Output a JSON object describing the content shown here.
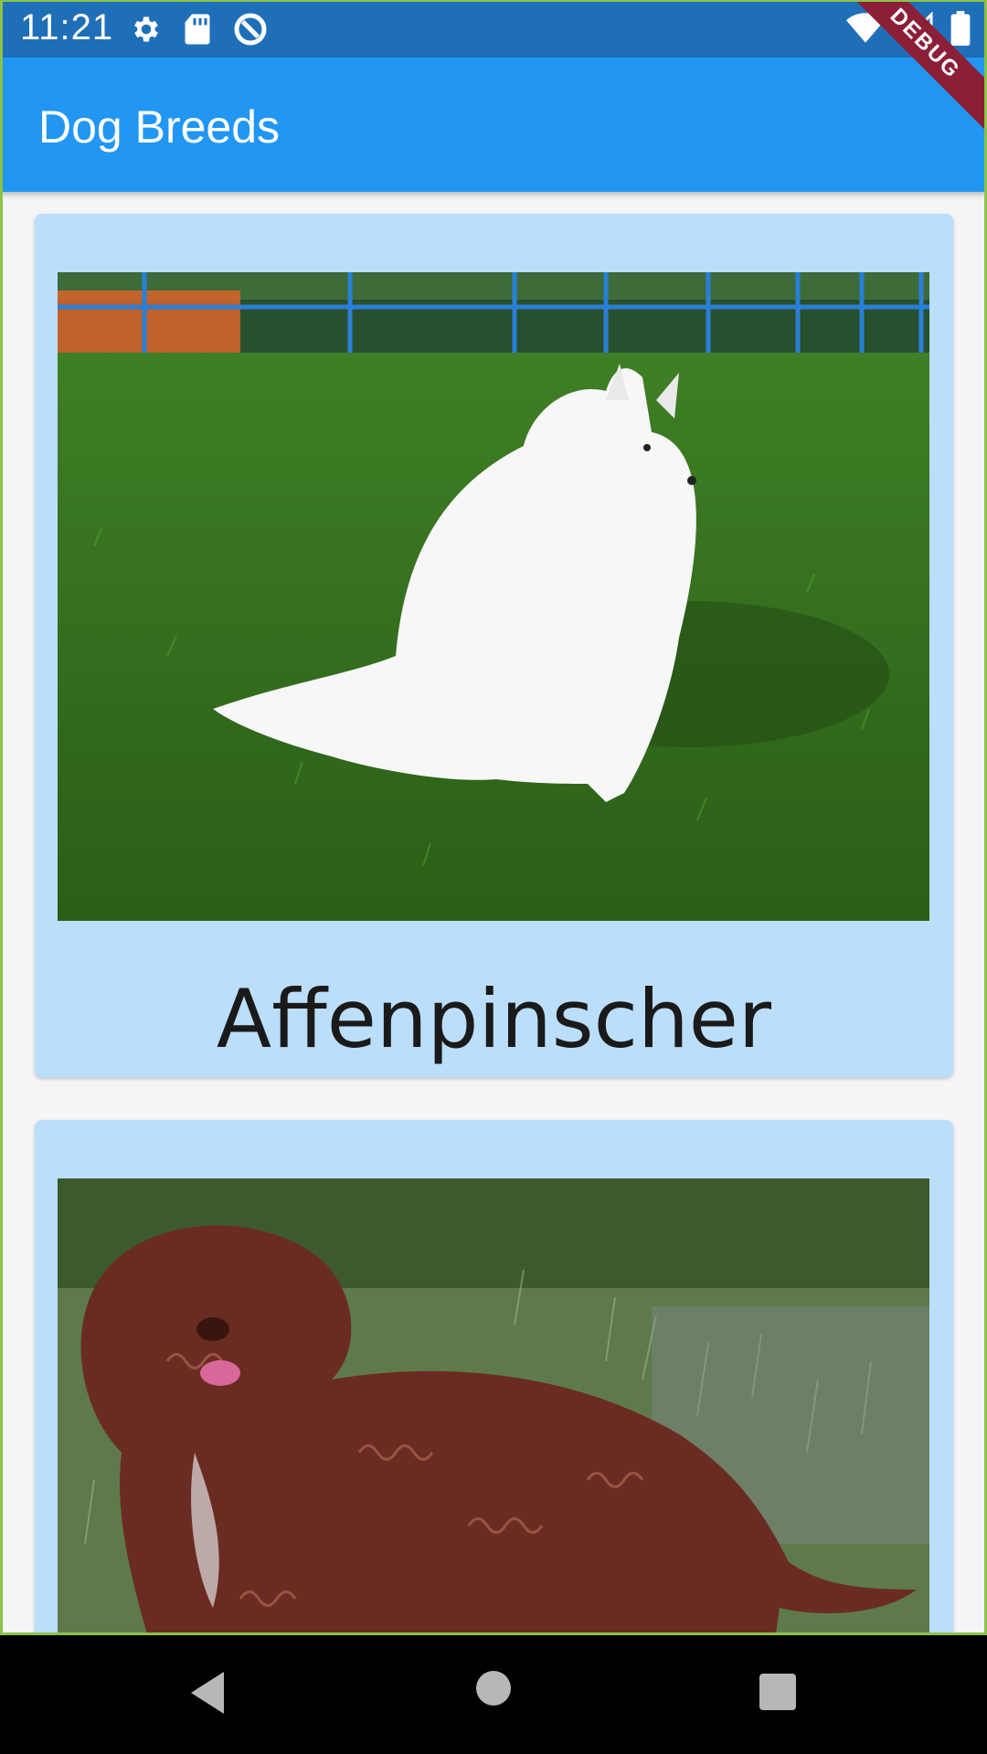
{
  "status_bar": {
    "time": "11:21",
    "icons_left": [
      "gear-icon",
      "sd-card-icon",
      "data-saver-icon"
    ],
    "icons_right": [
      "wifi-icon",
      "signal-icon",
      "battery-icon"
    ]
  },
  "debug_banner": "DEBUG",
  "app_bar": {
    "title": "Dog Breeds"
  },
  "breeds": [
    {
      "name": "Affenpinscher",
      "image": "white spitz-type dog sitting on grass"
    },
    {
      "name": "",
      "image": "brown curly-coated water dog standing on grass"
    }
  ],
  "nav_bar": {
    "buttons": [
      "back-icon",
      "home-icon",
      "recents-icon"
    ]
  },
  "colors": {
    "status_bar": "#1f6fb8",
    "app_bar": "#2196f3",
    "card": "#bbdefb",
    "debug": "#8b1f38"
  }
}
